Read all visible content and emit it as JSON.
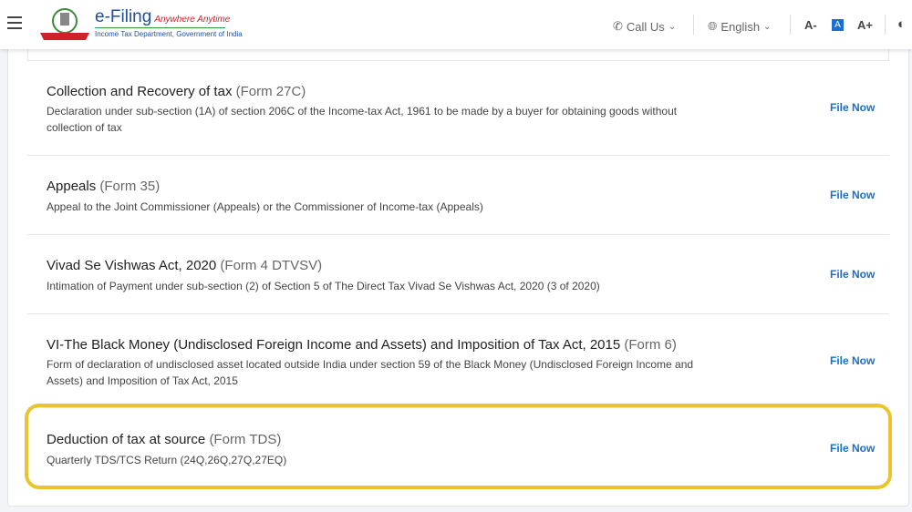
{
  "header": {
    "logo_title": "e-Filing",
    "logo_tagline": "Anywhere Anytime",
    "logo_subtitle": "Income Tax Department, Government of India",
    "call_us": "Call Us",
    "language": "English",
    "font_decrease": "A-",
    "font_default": "A",
    "font_increase": "A+"
  },
  "forms": [
    {
      "title": "Collection and Recovery of tax",
      "form": "(Form 27C)",
      "description": "Declaration under sub-section (1A) of section 206C of the Income-tax Act, 1961 to be made by a buyer for obtaining goods without collection of tax",
      "action": "File Now"
    },
    {
      "title": "Appeals",
      "form": "(Form 35)",
      "description": "Appeal to the Joint Commissioner (Appeals) or the Commissioner of Income-tax (Appeals)",
      "action": "File Now"
    },
    {
      "title": "Vivad Se Vishwas Act, 2020",
      "form": "(Form 4 DTVSV)",
      "description": "Intimation of Payment under sub-section (2) of Section 5 of The Direct Tax Vivad Se Vishwas Act, 2020 (3 of 2020)",
      "action": "File Now"
    },
    {
      "title": "VI-The Black Money (Undisclosed Foreign Income and Assets) and Imposition of Tax Act, 2015",
      "form": "(Form 6)",
      "description": "Form of declaration of undisclosed asset located outside India under section 59 of the Black Money (Undisclosed Foreign Income and Assets) and Imposition of Tax Act, 2015",
      "action": "File Now"
    },
    {
      "title": "Deduction of tax at source",
      "form": "(Form TDS)",
      "description": "Quarterly TDS/TCS Return (24Q,26Q,27Q,27EQ)",
      "action": "File Now"
    }
  ],
  "colors": {
    "highlight": "#e8c530",
    "link": "#1a6fc9"
  }
}
